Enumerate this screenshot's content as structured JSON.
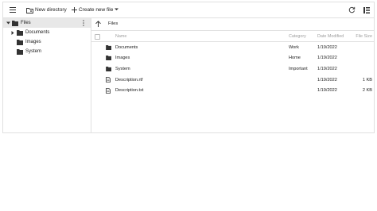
{
  "toolbar": {
    "menu_icon": "hamburger-menu-icon",
    "new_directory_label": "New directory",
    "create_new_file_label": "Create new file",
    "refresh_icon": "refresh-icon",
    "view_icon": "details-view-icon"
  },
  "tree": {
    "root": "Files",
    "items": [
      {
        "label": "Documents"
      },
      {
        "label": "Images"
      },
      {
        "label": "System"
      }
    ]
  },
  "content": {
    "breadcrumb": "Files",
    "columns": {
      "name": "Name",
      "category": "Category",
      "date": "Date Modified",
      "size": "File Size"
    },
    "rows": [
      {
        "icon": "folder-icon",
        "name": "Documents",
        "category": "Work",
        "date": "1/19/2022",
        "size": ""
      },
      {
        "icon": "folder-icon",
        "name": "Images",
        "category": "Home",
        "date": "1/19/2022",
        "size": ""
      },
      {
        "icon": "folder-icon",
        "name": "System",
        "category": "Important",
        "date": "1/19/2022",
        "size": ""
      },
      {
        "icon": "file-icon",
        "name": "Description.rtf",
        "category": "",
        "date": "1/19/2022",
        "size": "1 KB"
      },
      {
        "icon": "file-icon",
        "name": "Description.txt",
        "category": "",
        "date": "1/19/2022",
        "size": "2 KB"
      }
    ]
  }
}
